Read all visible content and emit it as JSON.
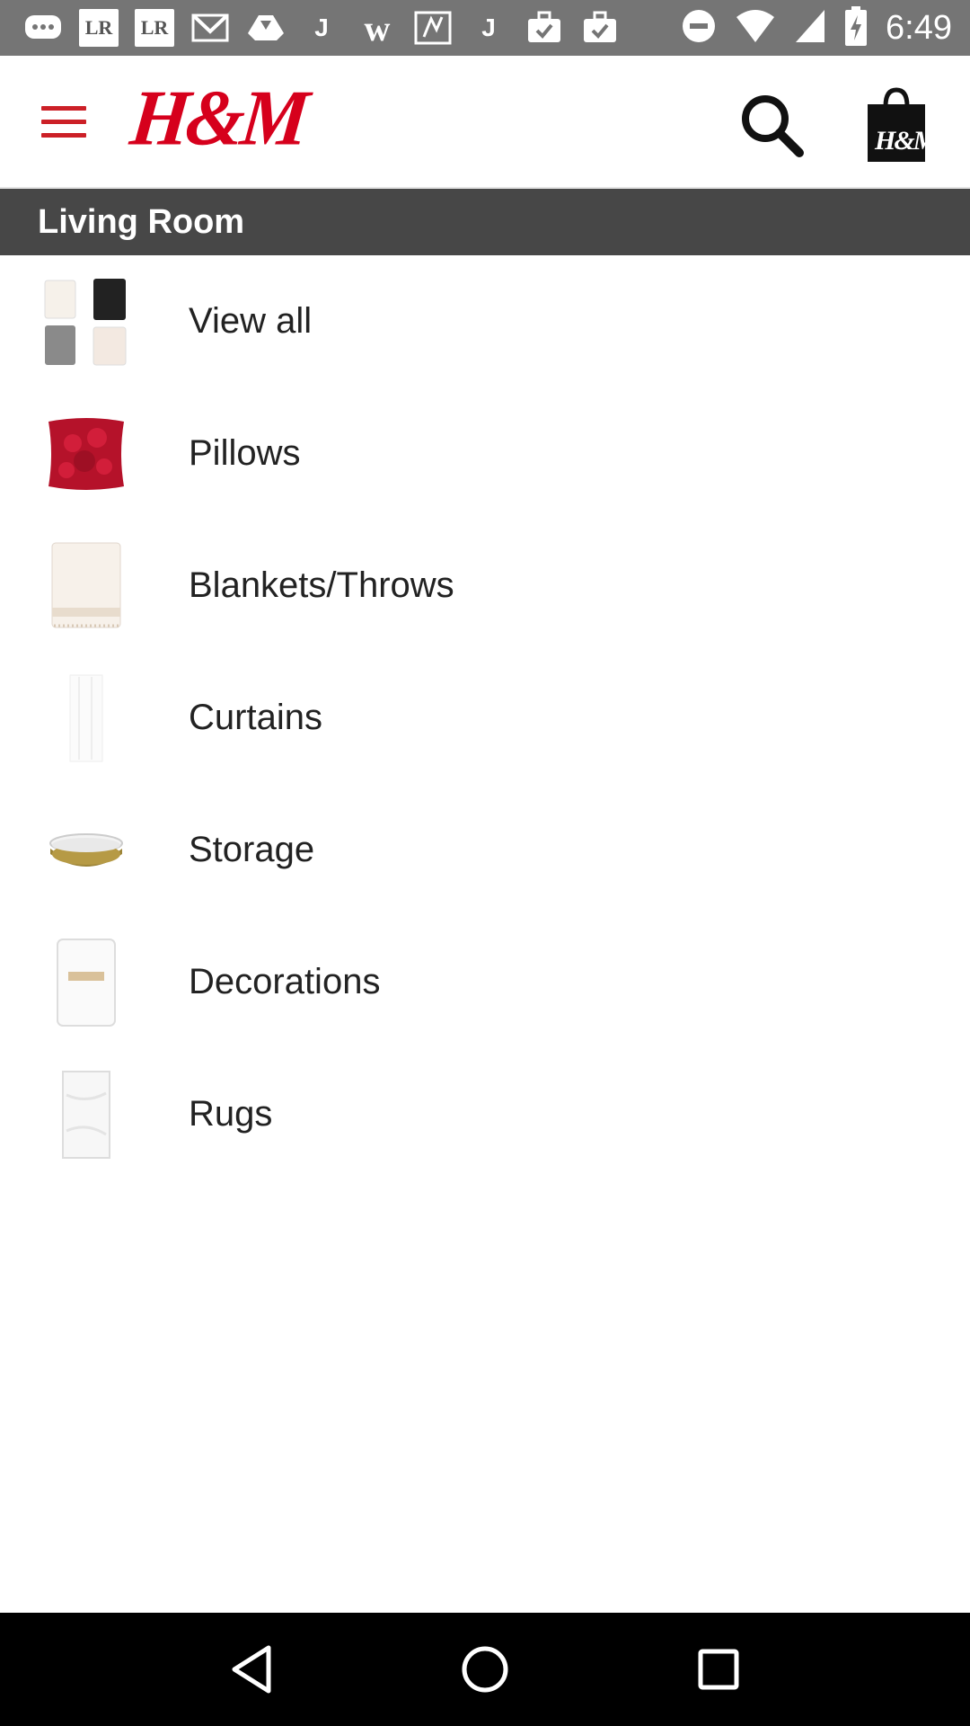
{
  "status_bar": {
    "time": "6:49",
    "left_icons": [
      "chat-bubble-icon",
      "lr-icon",
      "lr-icon",
      "gmail-icon",
      "drive-icon",
      "j-icon",
      "w-icon",
      "maps-icon",
      "j-icon",
      "briefcase-check-icon",
      "briefcase-check-icon"
    ],
    "lr_label": "LR",
    "right_icons": [
      "do-not-disturb-icon",
      "wifi-icon",
      "signal-icon",
      "battery-charging-icon"
    ]
  },
  "header": {
    "logo_text": "H&M",
    "brand_color": "#d6001c",
    "bag_logo_text": "H&M"
  },
  "section": {
    "title": "Living Room"
  },
  "categories": [
    {
      "label": "View all",
      "thumb": "candles-icon"
    },
    {
      "label": "Pillows",
      "thumb": "pillow-icon"
    },
    {
      "label": "Blankets/Throws",
      "thumb": "blanket-icon"
    },
    {
      "label": "Curtains",
      "thumb": "curtain-icon"
    },
    {
      "label": "Storage",
      "thumb": "storage-bowl-icon"
    },
    {
      "label": "Decorations",
      "thumb": "candle-icon"
    },
    {
      "label": "Rugs",
      "thumb": "rug-icon"
    }
  ],
  "nav": {
    "buttons": [
      "back-icon",
      "home-icon",
      "recents-icon"
    ]
  }
}
